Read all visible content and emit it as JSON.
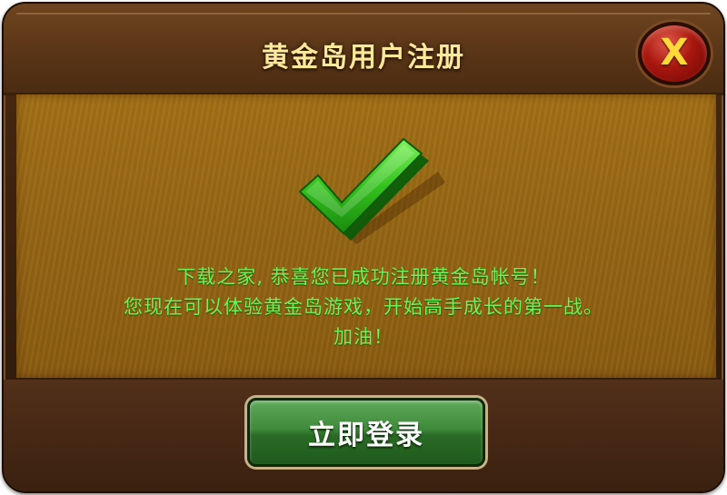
{
  "dialog": {
    "title": "黄金岛用户注册",
    "close_label": "X"
  },
  "message": {
    "lines": [
      "下载之家, 恭喜您已成功注册黄金岛帐号！",
      "您现在可以体验黄金岛游戏，开始高手成长的第一战。",
      "加油！"
    ]
  },
  "actions": {
    "login_label": "立即登录"
  },
  "icons": {
    "success": "check-icon",
    "close": "close-icon"
  },
  "colors": {
    "title_text": "#ffe89a",
    "message_text": "#6ef25a",
    "close_button": "#a8170f",
    "login_button": "#3f8a3a",
    "panel": "#946515"
  }
}
